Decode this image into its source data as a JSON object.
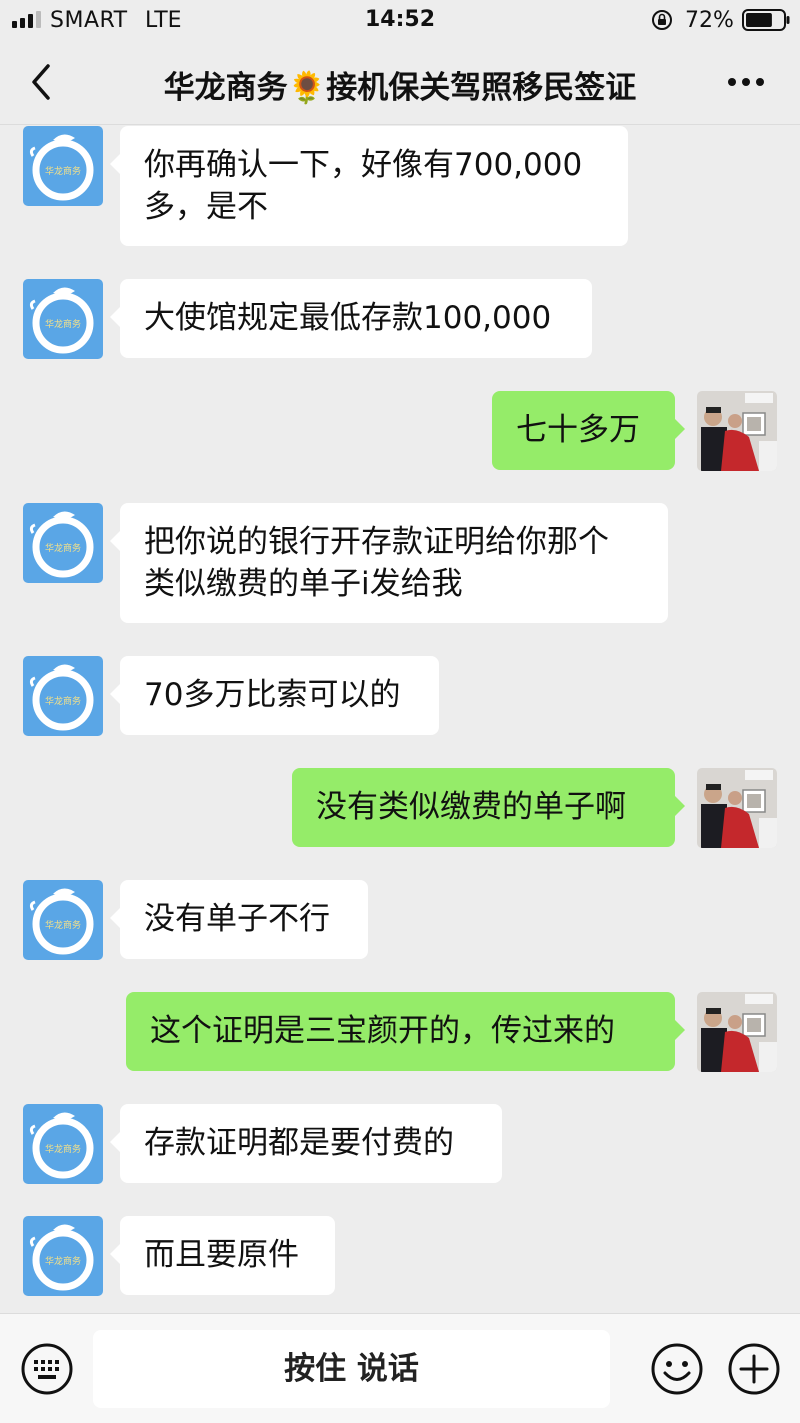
{
  "status_bar": {
    "carrier": "SMART",
    "network": "LTE",
    "time": "14:52",
    "battery_percent": "72%",
    "battery_level": 0.72
  },
  "nav": {
    "title": "华龙商务🌻接机保关驾照移民签证"
  },
  "messages": [
    {
      "side": "left",
      "text": "你再确认一下，好像有700,000\n多，是不"
    },
    {
      "side": "left",
      "text": "大使馆规定最低存款100,000"
    },
    {
      "side": "right",
      "text": "七十多万"
    },
    {
      "side": "left",
      "text": "把你说的银行开存款证明给你那个\n类似缴费的单子i发给我"
    },
    {
      "side": "left",
      "text": "70多万比索可以的"
    },
    {
      "side": "right",
      "text": "没有类似缴费的单子啊"
    },
    {
      "side": "left",
      "text": "没有单子不行"
    },
    {
      "side": "right",
      "text": "这个证明是三宝颜开的，传过来的"
    },
    {
      "side": "left",
      "text": "存款证明都是要付费的"
    },
    {
      "side": "left",
      "text": "而且要原件"
    }
  ],
  "contact_avatar": {
    "text": "华龙商务",
    "bg_color": "#5aa6e6"
  },
  "input_bar": {
    "hold_to_talk_label": "按住 说话"
  },
  "colors": {
    "background": "#ededed",
    "incoming_bubble": "#ffffff",
    "outgoing_bubble": "#95ec69"
  },
  "icons": {
    "back": "chevron-left-icon",
    "more": "more-dots-icon",
    "keyboard": "keyboard-icon",
    "emoji": "emoji-icon",
    "plus": "plus-icon"
  }
}
